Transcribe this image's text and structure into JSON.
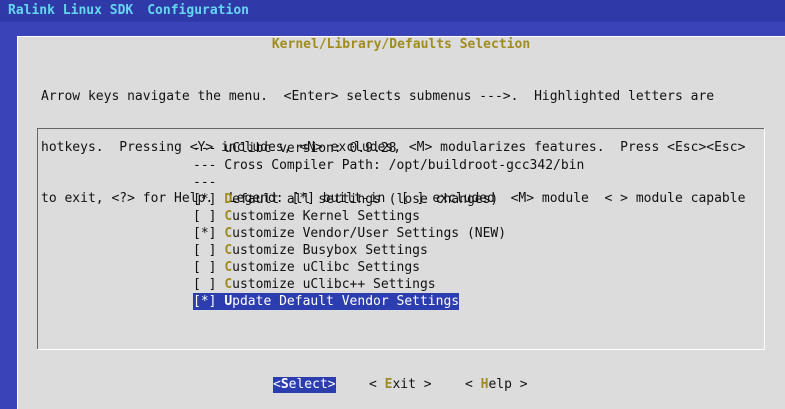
{
  "topbar": {
    "left": "Ralink Linux SDK",
    "right": "Configuration"
  },
  "dialog": {
    "title": "Kernel/Library/Defaults Selection",
    "help_line1": "Arrow keys navigate the menu.  <Enter> selects submenus --->.  Highlighted letters are",
    "help_line2": "hotkeys.  Pressing <Y> includes, <N> excludes, <M> modularizes features.  Press <Esc><Esc>",
    "help_line3": "to exit, <?> for Help.  Legend: [*] built-in  [ ] excluded  <M> module  < > module capable"
  },
  "menu": {
    "items": [
      {
        "prefix": "--- uClibc version: 0.9.28",
        "hot": "",
        "rest": ""
      },
      {
        "prefix": "--- Cross Compiler Path: /opt/buildroot-gcc342/bin",
        "hot": "",
        "rest": ""
      },
      {
        "prefix": "---",
        "hot": "",
        "rest": ""
      },
      {
        "prefix": "[*] ",
        "hot": "D",
        "rest": "efault all settings (lose changes)"
      },
      {
        "prefix": "[ ] ",
        "hot": "C",
        "rest": "ustomize Kernel Settings"
      },
      {
        "prefix": "[*] ",
        "hot": "C",
        "rest": "ustomize Vendor/User Settings (NEW)"
      },
      {
        "prefix": "[ ] ",
        "hot": "C",
        "rest": "ustomize Busybox Settings"
      },
      {
        "prefix": "[ ] ",
        "hot": "C",
        "rest": "ustomize uClibc Settings"
      },
      {
        "prefix": "[ ] ",
        "hot": "C",
        "rest": "ustomize uClibc++ Settings"
      },
      {
        "prefix": "[*] ",
        "hot": "U",
        "rest": "pdate Default Vendor Settings"
      }
    ]
  },
  "buttons": {
    "select": {
      "open": "<",
      "hot": "S",
      "rest": "elect>"
    },
    "exit": {
      "open": "< ",
      "hot": "E",
      "rest": "xit >"
    },
    "help": {
      "open": "< ",
      "hot": "H",
      "rest": "elp >"
    }
  },
  "colors": {
    "background": "#3a44b8",
    "dialog": "#dcdcdc",
    "highlight": "#2c3db0",
    "hotkey": "#a08c1e",
    "title": "#66d6f0"
  }
}
